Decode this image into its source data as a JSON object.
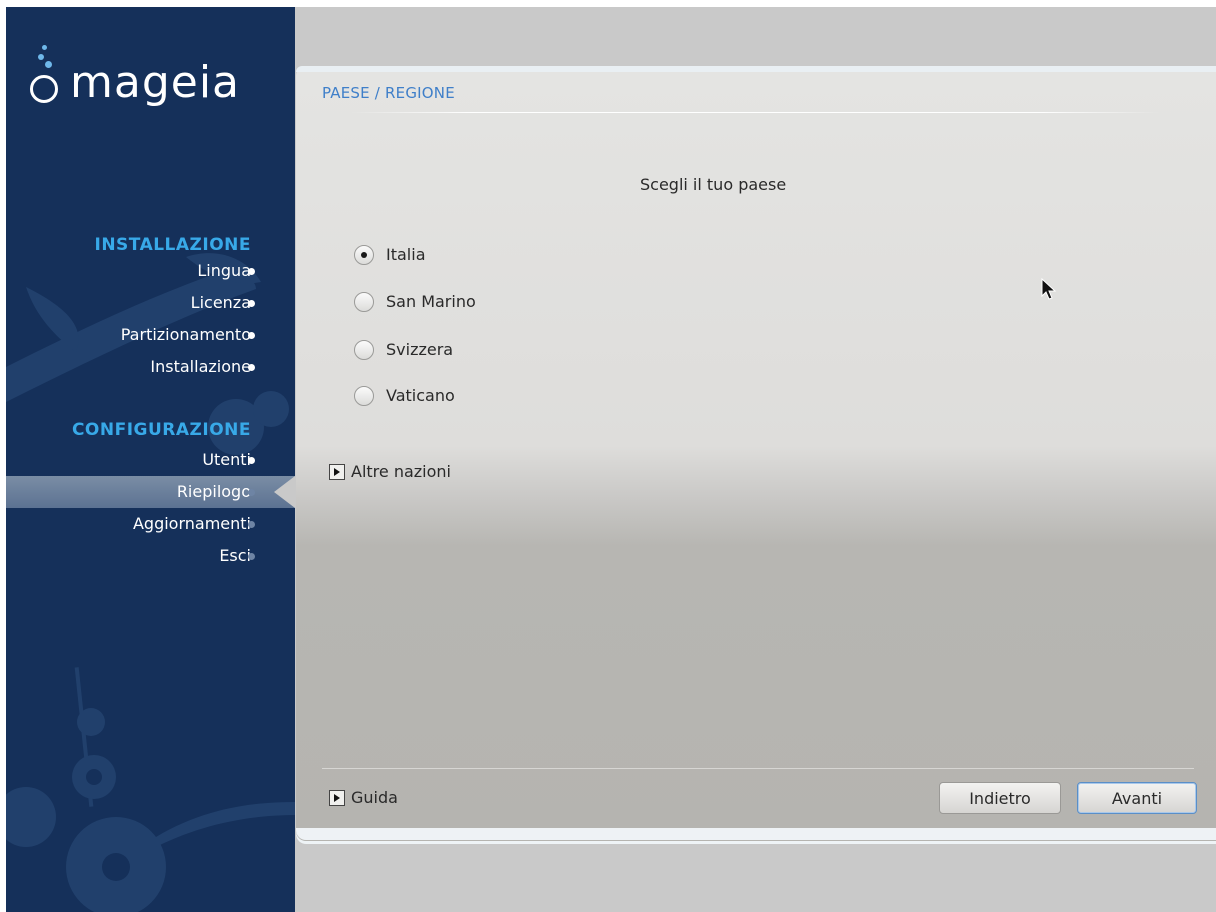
{
  "brand": {
    "name": "mageia"
  },
  "sidebar": {
    "sections": [
      {
        "title": "INSTALLAZIONE",
        "steps": [
          {
            "label": "Lingua",
            "done": true
          },
          {
            "label": "Licenza",
            "done": true
          },
          {
            "label": "Partizionamento",
            "done": true
          },
          {
            "label": "Installazione",
            "done": true
          }
        ]
      },
      {
        "title": "CONFIGURAZIONE",
        "steps": [
          {
            "label": "Utenti",
            "done": true
          },
          {
            "label": "Riepilogo",
            "done": false,
            "current": true
          },
          {
            "label": "Aggiornamenti",
            "done": false
          },
          {
            "label": "Esci",
            "done": false
          }
        ]
      }
    ]
  },
  "main": {
    "heading": "PAESE / REGIONE",
    "prompt": "Scegli il tuo paese",
    "countries": [
      {
        "label": "Italia",
        "selected": true
      },
      {
        "label": "San Marino",
        "selected": false
      },
      {
        "label": "Svizzera",
        "selected": false
      },
      {
        "label": "Vaticano",
        "selected": false
      }
    ],
    "more_countries_label": "Altre nazioni",
    "help_label": "Guida",
    "back_label": "Indietro",
    "next_label": "Avanti"
  },
  "colors": {
    "sidebar_bg": "#15305a",
    "section_title": "#38a9e8",
    "heading": "#3f7fc9",
    "desktop_bg": "#c9c9c9"
  }
}
